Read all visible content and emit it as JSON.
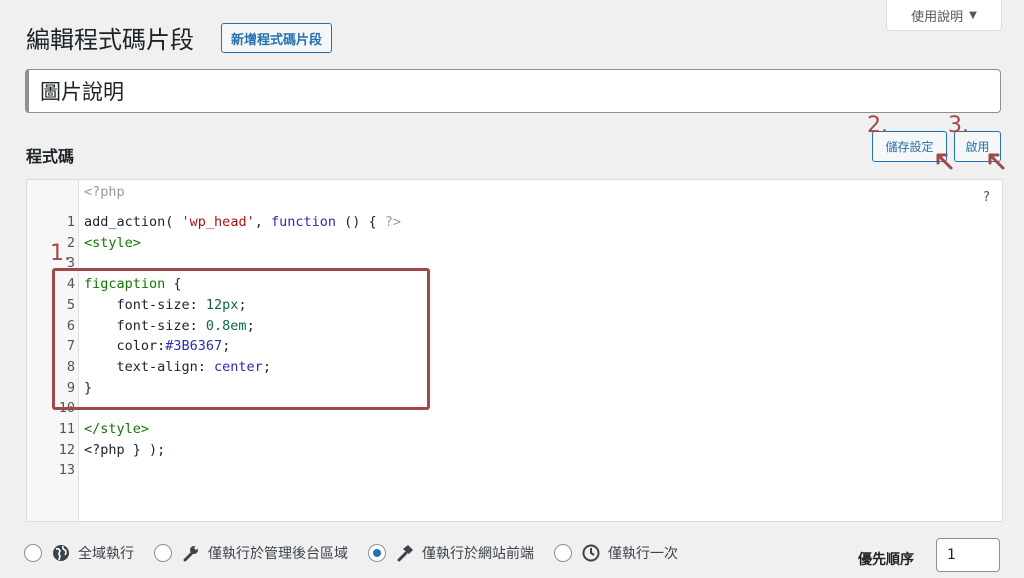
{
  "header": {
    "help_label": "使用說明",
    "title": "編輯程式碼片段",
    "add_new_label": "新增程式碼片段"
  },
  "snippet": {
    "title_value": "圖片說明"
  },
  "code_section": {
    "title": "程式碼",
    "save_label": "儲存設定",
    "activate_label": "啟用",
    "help_mark": "?",
    "php_open": "<?php",
    "lines": [
      {
        "num": "1",
        "parts": [
          [
            "def",
            "add_action( "
          ],
          [
            "str",
            "'wp_head'"
          ],
          [
            "def",
            ", "
          ],
          [
            "kw",
            "function"
          ],
          [
            "def",
            " () { "
          ],
          [
            "gray",
            "?>"
          ]
        ]
      },
      {
        "num": "2",
        "parts": [
          [
            "tag",
            "<style>"
          ]
        ]
      },
      {
        "num": "3",
        "parts": []
      },
      {
        "num": "4",
        "parts": [
          [
            "tag",
            "figcaption"
          ],
          [
            "def",
            " {"
          ]
        ]
      },
      {
        "num": "5",
        "parts": [
          [
            "def",
            "    font-size: "
          ],
          [
            "num",
            "12px"
          ],
          [
            "def",
            ";"
          ]
        ]
      },
      {
        "num": "6",
        "parts": [
          [
            "def",
            "    font-size: "
          ],
          [
            "num",
            "0.8em"
          ],
          [
            "def",
            ";"
          ]
        ]
      },
      {
        "num": "7",
        "parts": [
          [
            "def",
            "    color:"
          ],
          [
            "color",
            "#3B6367"
          ],
          [
            "def",
            ";"
          ]
        ]
      },
      {
        "num": "8",
        "parts": [
          [
            "def",
            "    text-align: "
          ],
          [
            "kw",
            "center"
          ],
          [
            "def",
            ";"
          ]
        ]
      },
      {
        "num": "9",
        "parts": [
          [
            "def",
            "}"
          ]
        ]
      },
      {
        "num": "10",
        "parts": []
      },
      {
        "num": "11",
        "parts": [
          [
            "tag",
            "</style>"
          ]
        ]
      },
      {
        "num": "12",
        "parts": [
          [
            "def",
            "<?php } );"
          ]
        ]
      },
      {
        "num": "13",
        "parts": []
      }
    ]
  },
  "annotations": {
    "step1": "1.",
    "step2": "2.",
    "step3": "3."
  },
  "scope": {
    "options": [
      {
        "label": "全域執行",
        "icon": "globe-icon",
        "checked": false
      },
      {
        "label": "僅執行於管理後台區域",
        "icon": "wrench-icon",
        "checked": false
      },
      {
        "label": "僅執行於網站前端",
        "icon": "hammer-icon",
        "checked": true
      },
      {
        "label": "僅執行一次",
        "icon": "clock-icon",
        "checked": false
      }
    ]
  },
  "priority": {
    "label": "優先順序",
    "value": "1"
  },
  "colors": {
    "accent": "#2271b1",
    "annotation": "#a0484a"
  }
}
